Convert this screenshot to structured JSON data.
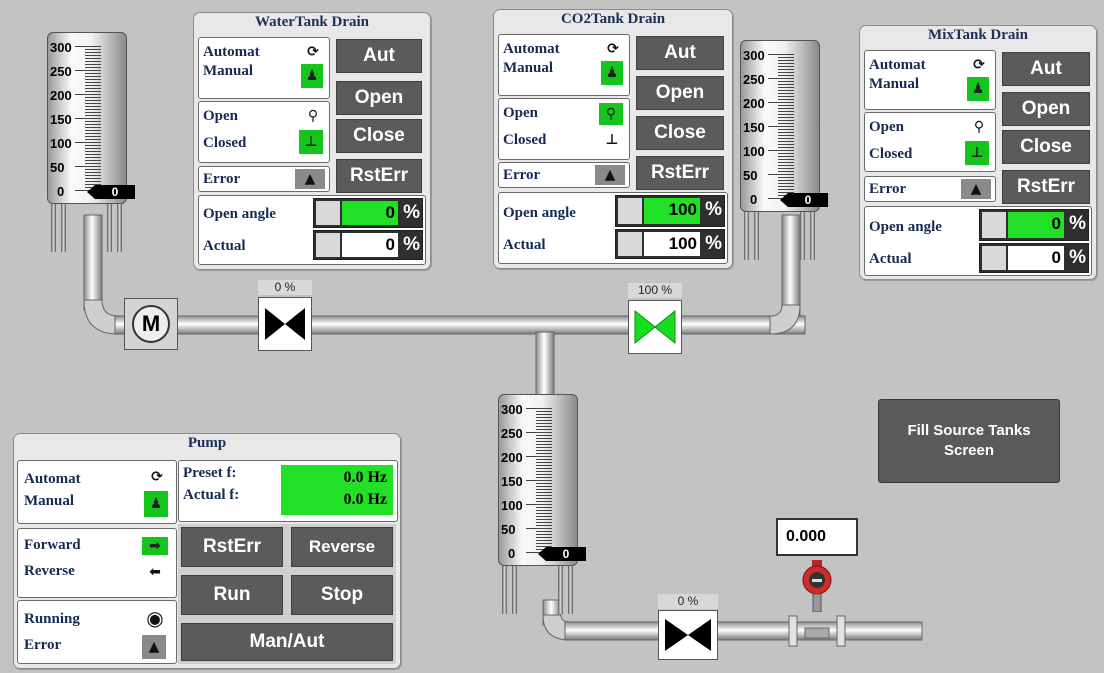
{
  "water_tank_drain": {
    "title": "WaterTank Drain",
    "mode": {
      "automat": "Automat",
      "manual": "Manual"
    },
    "valve_state": {
      "open": "Open",
      "closed": "Closed"
    },
    "error": "Error",
    "open_angle_label": "Open angle",
    "actual_label": "Actual",
    "open_angle_value": "0",
    "actual_value": "0",
    "unit": "%",
    "buttons": {
      "aut": "Aut",
      "open": "Open",
      "close": "Close",
      "rsterr": "RstErr"
    }
  },
  "co2_tank_drain": {
    "title": "CO2Tank  Drain",
    "mode": {
      "automat": "Automat",
      "manual": "Manual"
    },
    "valve_state": {
      "open": "Open",
      "closed": "Closed"
    },
    "error": "Error",
    "open_angle_label": "Open angle",
    "actual_label": "Actual",
    "open_angle_value": "100",
    "actual_value": "100",
    "unit": "%",
    "buttons": {
      "aut": "Aut",
      "open": "Open",
      "close": "Close",
      "rsterr": "RstErr"
    }
  },
  "mix_tank_drain": {
    "title": "MixTank  Drain",
    "mode": {
      "automat": "Automat",
      "manual": "Manual"
    },
    "valve_state": {
      "open": "Open",
      "closed": "Closed"
    },
    "error": "Error",
    "open_angle_label": "Open angle",
    "actual_label": "Actual",
    "open_angle_value": "0",
    "actual_value": "0",
    "unit": "%",
    "buttons": {
      "aut": "Aut",
      "open": "Open",
      "close": "Close",
      "rsterr": "RstErr"
    }
  },
  "pump": {
    "title": "Pump",
    "mode": {
      "automat": "Automat",
      "manual": "Manual"
    },
    "preset_label": "Preset f:",
    "actual_label": "Actual f:",
    "preset_value": "0.0 Hz",
    "actual_value": "0.0 Hz",
    "direction": {
      "forward": "Forward",
      "reverse": "Reverse"
    },
    "status": {
      "running": "Running",
      "error": "Error"
    },
    "buttons": {
      "rsterr": "RstErr",
      "reverse": "Reverse",
      "run": "Run",
      "stop": "Stop",
      "manaut": "Man/Aut"
    }
  },
  "tanks": {
    "scale": [
      "300",
      "250",
      "200",
      "150",
      "100",
      "50",
      "0"
    ],
    "water_level": "0",
    "co2_level": "0",
    "mix_level": "0"
  },
  "motor": {
    "label": "M"
  },
  "valves": {
    "water_valve_pct": "0 %",
    "co2_valve_pct": "100 %",
    "outlet_valve_pct": "0 %"
  },
  "flow_meter": {
    "value": "0.000"
  },
  "fill_button": {
    "label": "Fill Source Tanks Screen"
  },
  "colors": {
    "active_green": "#16c41e",
    "button_grey": "#5b5b5b",
    "background": "#c3c3c3",
    "title_blue": "#1c2f58"
  }
}
